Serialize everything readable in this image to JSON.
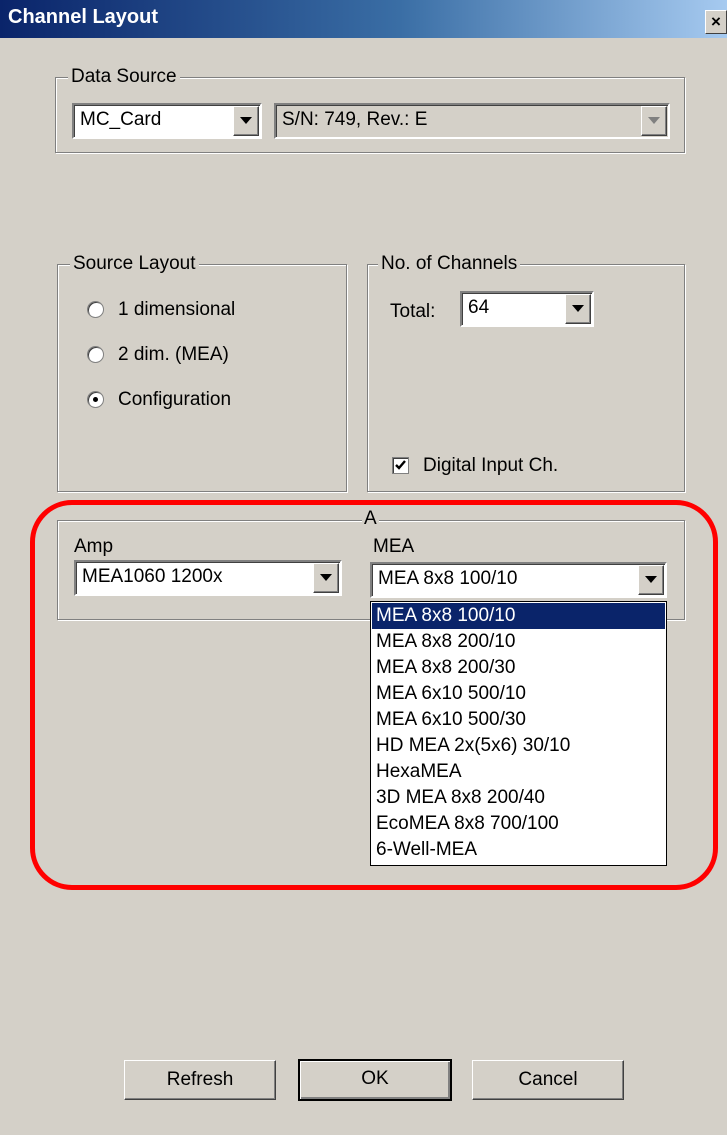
{
  "window": {
    "title": "Channel Layout",
    "close_glyph": "×"
  },
  "data_source": {
    "legend": "Data Source",
    "source_value": "MC_Card",
    "serial_value": "S/N: 749, Rev.: E"
  },
  "source_layout": {
    "legend": "Source Layout",
    "options": [
      "1 dimensional",
      "2 dim. (MEA)",
      "Configuration"
    ],
    "selected": "Configuration"
  },
  "channels": {
    "legend": "No. of Channels",
    "total_label": "Total:",
    "total_value": "64",
    "digital_input_label": "Digital Input Ch.",
    "digital_input_checked": true
  },
  "config_group": {
    "legend": "A",
    "amp_label": "Amp",
    "amp_value": "MEA1060 1200x",
    "mea_label": "MEA",
    "mea_value": "MEA 8x8 100/10",
    "mea_options": [
      "MEA 8x8 100/10",
      "MEA 8x8 200/10",
      "MEA 8x8 200/30",
      "MEA 6x10 500/10",
      "MEA 6x10 500/30",
      "HD MEA 2x(5x6) 30/10",
      "HexaMEA",
      "3D MEA 8x8 200/40",
      "EcoMEA 8x8 700/100",
      "6-Well-MEA"
    ],
    "mea_selected_index": 0
  },
  "buttons": {
    "refresh": "Refresh",
    "ok": "OK",
    "cancel": "Cancel"
  },
  "annotation": {
    "color": "#ff0000",
    "shape": "rounded-rectangle"
  },
  "colors": {
    "dialog_bg": "#d4d0c8",
    "selection": "#0a246a",
    "title_start": "#0a246a",
    "title_end": "#a6caf0"
  }
}
